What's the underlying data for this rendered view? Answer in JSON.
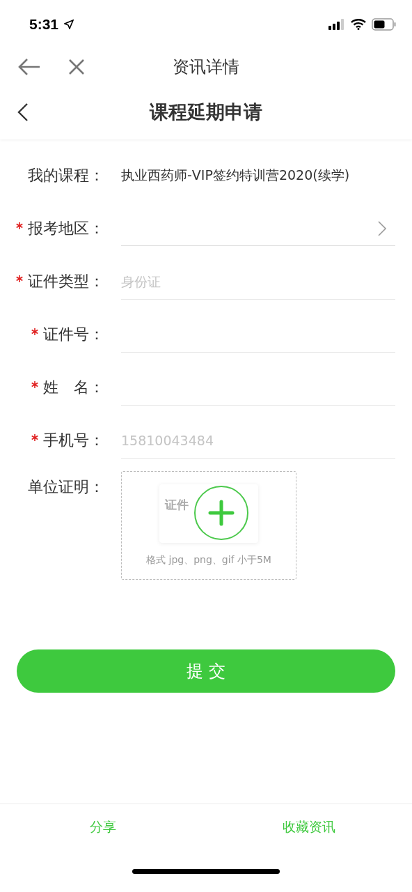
{
  "status_bar": {
    "time": "5:31"
  },
  "browser_bar": {
    "title": "资讯详情"
  },
  "page_header": {
    "title": "课程延期申请"
  },
  "form": {
    "rows": [
      {
        "label": "我的课程：",
        "required": false,
        "kind": "static",
        "value": "执业西药师-VIP签约特训营2020(续学)"
      },
      {
        "label": "报考地区：",
        "required": true,
        "kind": "select"
      },
      {
        "label": "证件类型：",
        "required": true,
        "kind": "input",
        "placeholder": "身份证"
      },
      {
        "label": "证件号：",
        "required": true,
        "kind": "input"
      },
      {
        "label": "姓　名：",
        "required": true,
        "kind": "input"
      },
      {
        "label": "手机号：",
        "required": true,
        "kind": "input",
        "placeholder": "15810043484"
      },
      {
        "label": "单位证明：",
        "required": false,
        "kind": "upload",
        "sample_text": "证件",
        "hint": "格式 jpg、png、gif 小于5M"
      }
    ]
  },
  "submit": {
    "label": "提 交"
  },
  "bottom_bar": {
    "items": [
      "分享",
      "收藏资讯"
    ]
  }
}
